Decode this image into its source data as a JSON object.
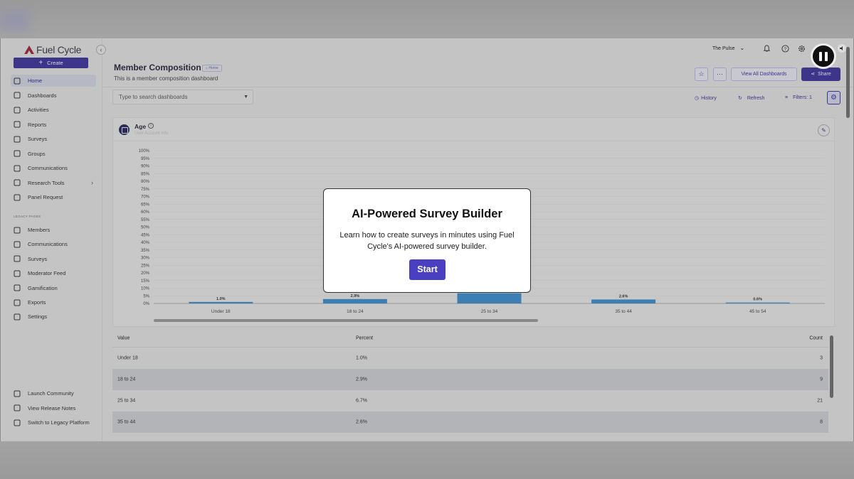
{
  "app": {
    "logo_text": "Fuel Cycle",
    "create_label": "Create",
    "workspace": "The Pulse"
  },
  "sidebar": {
    "items": [
      {
        "label": "Home",
        "icon": "home-icon"
      },
      {
        "label": "Dashboards",
        "icon": "dashboard-icon"
      },
      {
        "label": "Activities",
        "icon": "document-icon"
      },
      {
        "label": "Reports",
        "icon": "trend-icon"
      },
      {
        "label": "Surveys",
        "icon": "list-icon"
      },
      {
        "label": "Groups",
        "icon": "group-add-icon"
      },
      {
        "label": "Communications",
        "icon": "mail-icon"
      },
      {
        "label": "Research Tools",
        "icon": "tools-icon"
      },
      {
        "label": "Panel Request",
        "icon": "person-search-icon"
      }
    ],
    "legacy_label": "LEGACY PAGES",
    "legacy_items": [
      {
        "label": "Members",
        "icon": "members-icon"
      },
      {
        "label": "Communications",
        "icon": "mail-icon"
      },
      {
        "label": "Surveys",
        "icon": "list-icon"
      },
      {
        "label": "Moderator Feed",
        "icon": "feed-icon"
      },
      {
        "label": "Gamification",
        "icon": "trophy-icon"
      },
      {
        "label": "Exports",
        "icon": "export-icon"
      },
      {
        "label": "Settings",
        "icon": "settings-person-icon"
      }
    ],
    "footer_items": [
      {
        "label": "Launch Community",
        "icon": "launch-icon"
      },
      {
        "label": "View Release Notes",
        "icon": "megaphone-icon"
      },
      {
        "label": "Switch to Legacy Platform",
        "icon": "arrow-left-icon"
      }
    ]
  },
  "header": {
    "title": "Member Composition",
    "badge": "Home",
    "subtitle": "This is a member composition dashboard",
    "view_all_label": "View All Dashboards",
    "share_label": "Share"
  },
  "toolbar": {
    "search_placeholder": "Type to search dashboards",
    "history_label": "History",
    "refresh_label": "Refresh",
    "filters_label": "Filters: 1"
  },
  "card": {
    "title": "Age",
    "subtitle": "User Account Info"
  },
  "chart_data": {
    "type": "bar",
    "categories": [
      "Under 18",
      "18 to 24",
      "25 to 34",
      "35 to 44",
      "45 to 54"
    ],
    "values": [
      1.0,
      2.9,
      6.7,
      2.6,
      0.6
    ],
    "data_labels": [
      "1.0%",
      "2.9%",
      "",
      "2.6%",
      "0.6%"
    ],
    "y_ticks": [
      "100%",
      "95%",
      "90%",
      "85%",
      "80%",
      "75%",
      "70%",
      "65%",
      "60%",
      "55%",
      "50%",
      "45%",
      "40%",
      "35%",
      "30%",
      "25%",
      "20%",
      "15%",
      "10%",
      "5%",
      "0%"
    ],
    "ylim": [
      0,
      100
    ],
    "grid": true,
    "bar_color": "#3d7fb3"
  },
  "table": {
    "headers": [
      "Value",
      "Percent",
      "Count"
    ],
    "rows": [
      [
        "Under 18",
        "1.0%",
        "3"
      ],
      [
        "18 to 24",
        "2.9%",
        "9"
      ],
      [
        "25 to 34",
        "6.7%",
        "21"
      ],
      [
        "35 to 44",
        "2.6%",
        "8"
      ]
    ]
  },
  "modal": {
    "title": "AI-Powered Survey Builder",
    "body": "Learn how to create surveys in minutes using Fuel Cycle's AI-powered survey builder.",
    "start_label": "Start"
  },
  "colors": {
    "accent": "#3d3589",
    "modal_button": "#4a3fc0"
  }
}
